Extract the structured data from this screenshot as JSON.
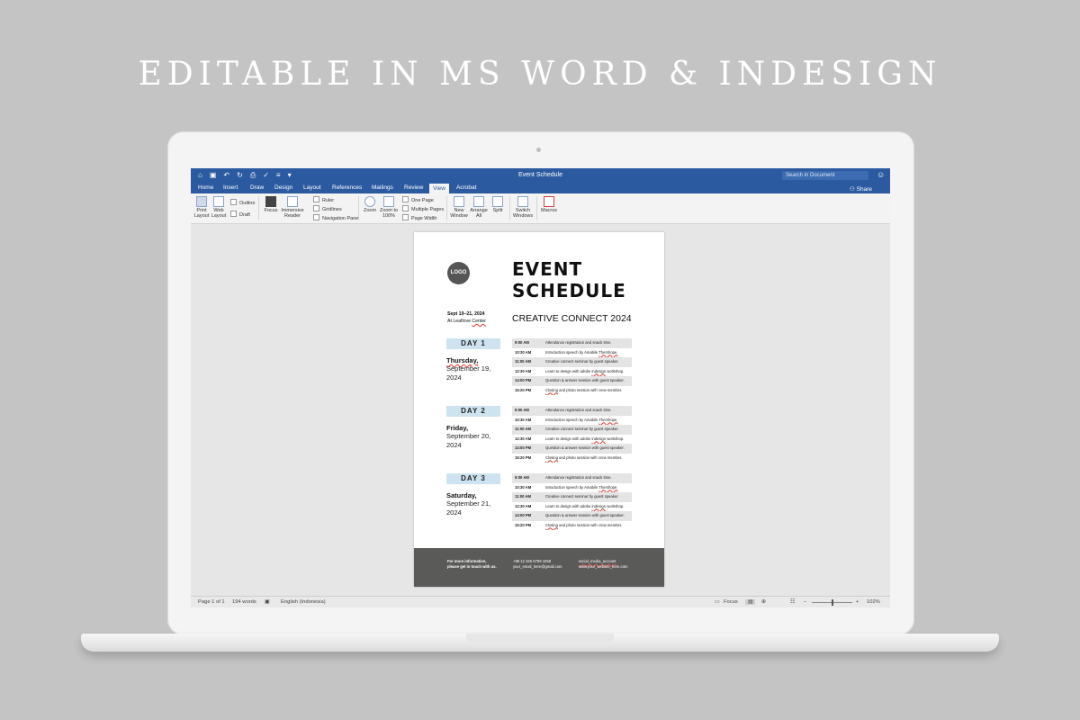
{
  "headline": "EDITABLE IN MS WORD & INDESIGN",
  "window": {
    "title": "Event Schedule",
    "search_placeholder": "Search in Document",
    "share_label": "Share"
  },
  "tabs": [
    "Home",
    "Insert",
    "Draw",
    "Design",
    "Layout",
    "References",
    "Mailings",
    "Review",
    "View",
    "Acrobat"
  ],
  "active_tab": "View",
  "ribbon": {
    "print_layout": "Print Layout",
    "web_layout": "Web Layout",
    "outline": "Outline",
    "draft": "Draft",
    "focus": "Focus",
    "immersive_reader": "Immersive Reader",
    "ruler": "Ruler",
    "gridlines": "Gridlines",
    "navigation_pane": "Navigation Pane",
    "zoom": "Zoom",
    "zoom_100": "Zoom to 100%",
    "one_page": "One Page",
    "multiple_pages": "Multiple Pages",
    "page_width": "Page Width",
    "new_window": "New Window",
    "arrange_all": "Arrange All",
    "split": "Split",
    "switch_windows": "Switch Windows",
    "macros": "Macros"
  },
  "document": {
    "logo": "LOGO",
    "title_line1": "EVENT",
    "title_line2": "SCHEDULE",
    "subtitle": "CREATIVE CONNECT 2024",
    "date_range": "Sept 19–21, 2024",
    "location_prefix": "At Leaflove ",
    "location_word": "Center",
    "days": [
      {
        "label": "DAY 1",
        "weekday": "Thursday,",
        "date": "September 19, 2024"
      },
      {
        "label": "DAY 2",
        "weekday": "Friday,",
        "date": "September 20, 2024"
      },
      {
        "label": "DAY 3",
        "weekday": "Saturday,",
        "date": "September 21, 2024"
      }
    ],
    "schedule": [
      {
        "time": "9:00 AM",
        "desc": "Attendance registration and snack time."
      },
      {
        "time": "10:30 AM",
        "desc": "Introduction speech by Amabile Thershope."
      },
      {
        "time": "11:00 AM",
        "desc": "Creative connect seminar by guest speaker."
      },
      {
        "time": "12:30 AM",
        "desc": "Learn to design with adobe indesign workshop."
      },
      {
        "time": "14:00 PM",
        "desc": "Question & answer session with guest speaker."
      },
      {
        "time": "15:20 PM",
        "desc": "Closing and photo session with crew member."
      }
    ],
    "footer": {
      "info_line1": "For more information,",
      "info_line2": "please get in touch with us.",
      "phone": "+88 12 345 6789 1058",
      "email": "your_email_here@gmail.com",
      "social": "social_media_account",
      "website": "www.your_website_here.com"
    }
  },
  "statusbar": {
    "page": "Page 1 of 1",
    "words": "194 words",
    "language": "English (Indonesia)",
    "focus": "Focus",
    "zoom": "102%"
  },
  "colors": {
    "titlebar": "#2c5aa0",
    "day_badge": "#cde3ef",
    "footer": "#5a5a59"
  }
}
